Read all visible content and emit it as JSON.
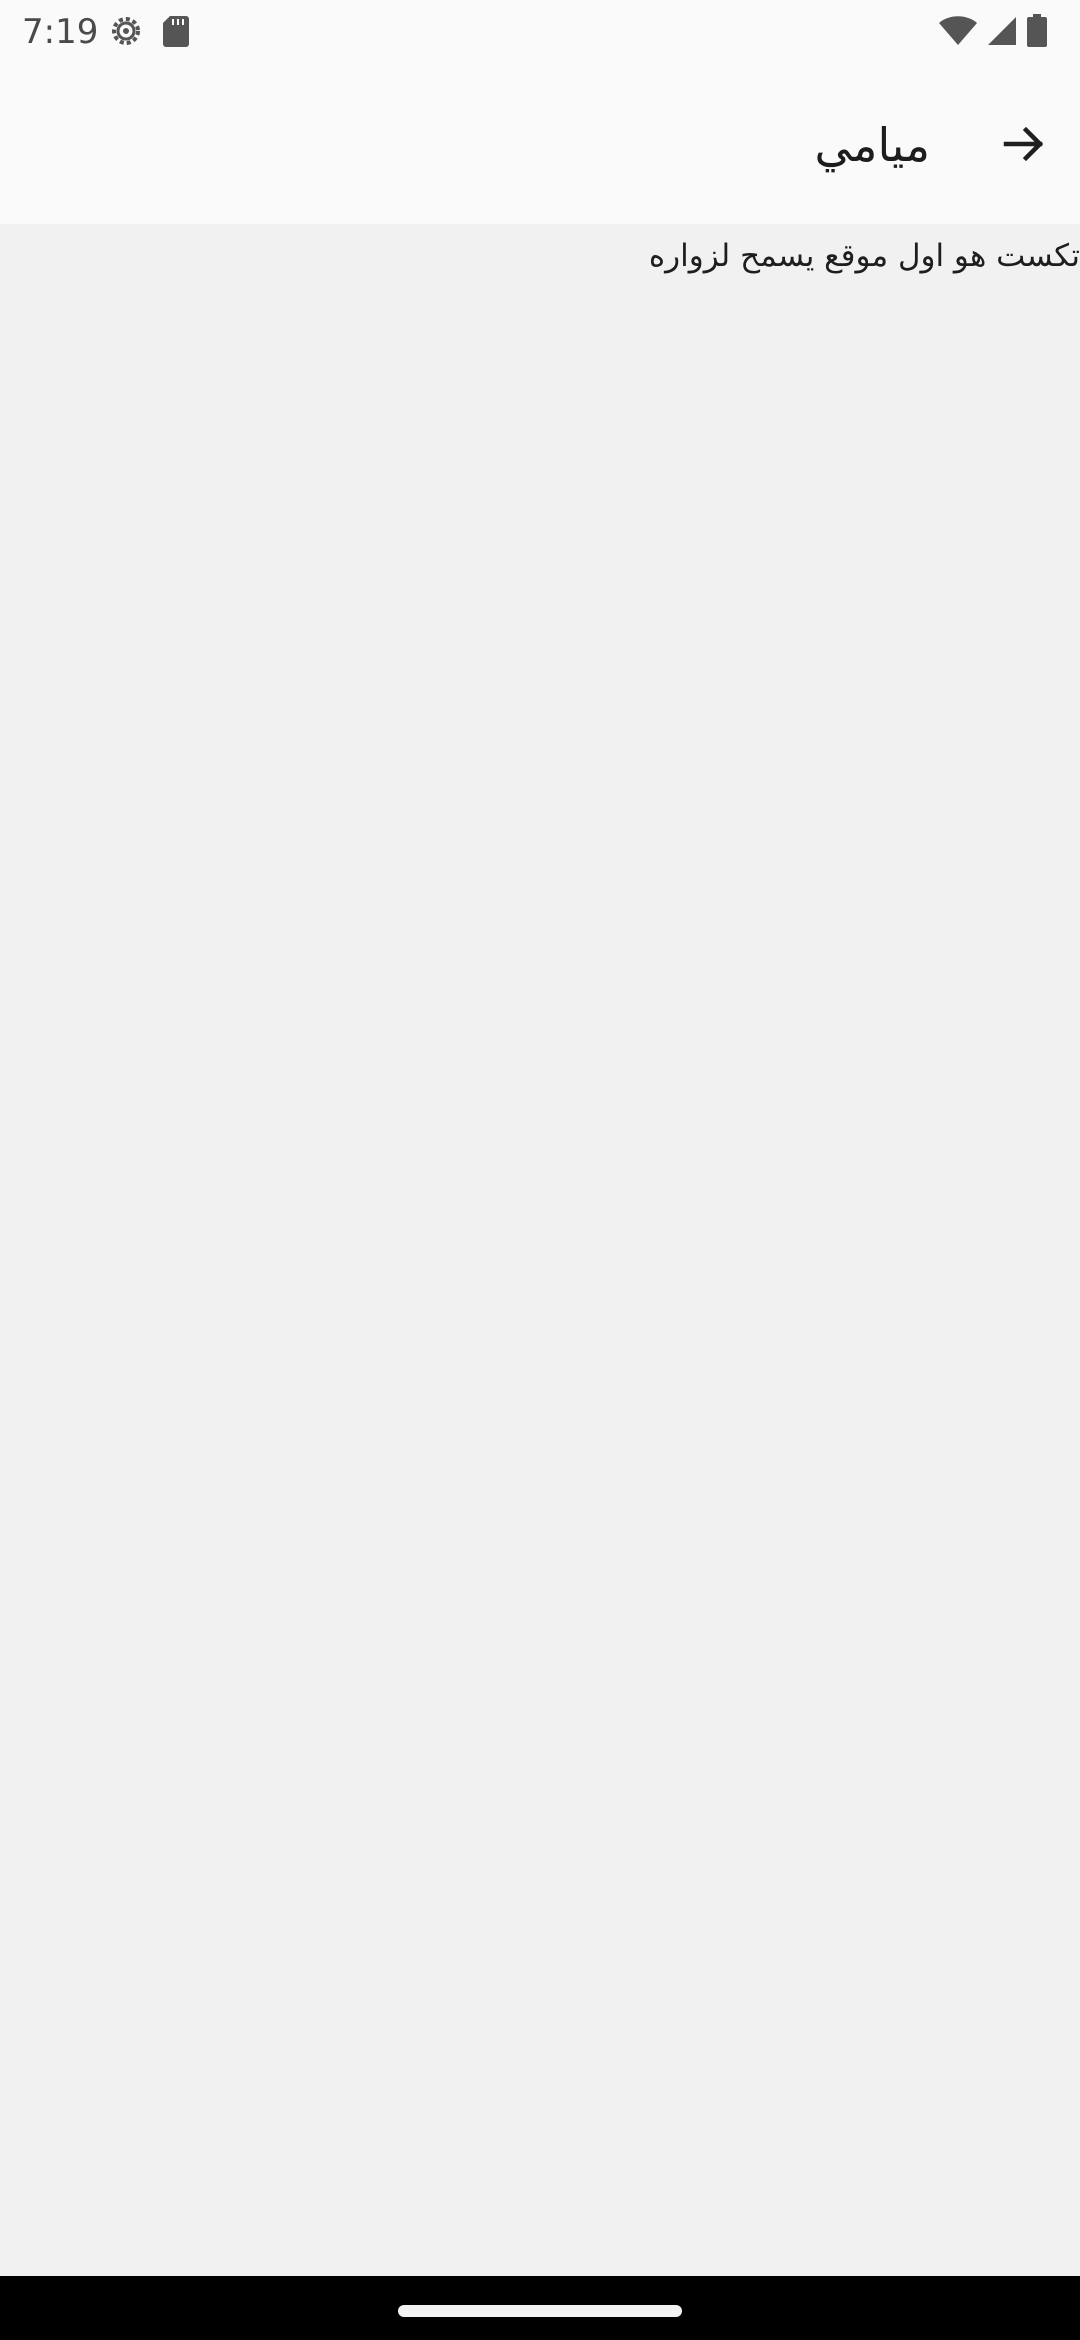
{
  "status_bar": {
    "time": "7:19",
    "left_icons": [
      "settings-gear-icon",
      "sd-card-icon"
    ],
    "right_icons": [
      "wifi-icon",
      "cell-signal-icon",
      "battery-icon"
    ]
  },
  "app_bar": {
    "title": "ميامي",
    "back_icon": "arrow-back-icon"
  },
  "content": {
    "text": "تكست هو اول موقع يسمح لزواره"
  },
  "colors": {
    "background": "#f1f1f1",
    "app_bar": "#fafafa",
    "text": "#1e1e1e",
    "nav_bar": "#000000"
  }
}
